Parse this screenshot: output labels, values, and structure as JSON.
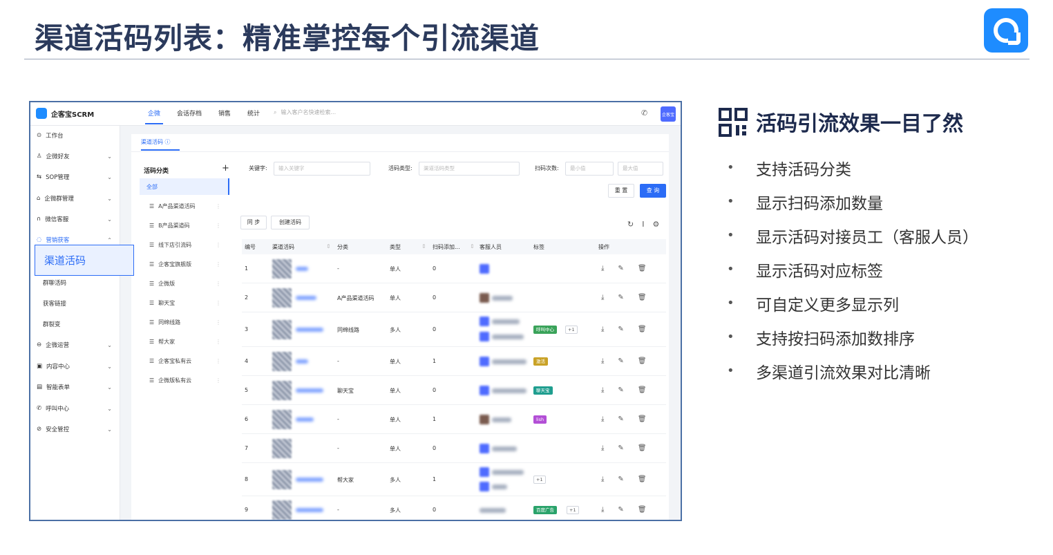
{
  "slide": {
    "title": "渠道活码列表：精准掌控每个引流渠道"
  },
  "app": {
    "logo_text": "企客宝SCRM",
    "nav": [
      "企微",
      "会话存档",
      "销售",
      "统计"
    ],
    "search_placeholder": "输入客户名快速检索...",
    "avatar_label": "企客宝",
    "sidebar": [
      {
        "label": "工作台",
        "icon": "home-icon"
      },
      {
        "label": "企微好友",
        "icon": "user-icon"
      },
      {
        "label": "SOP管理",
        "icon": "sop-icon"
      },
      {
        "label": "企微群管理",
        "icon": "group-icon"
      },
      {
        "label": "微信客服",
        "icon": "headset-icon"
      },
      {
        "label": "营销获客",
        "icon": "marketing-icon"
      },
      {
        "label": "群聊活码",
        "icon": ""
      },
      {
        "label": "获客链接",
        "icon": ""
      },
      {
        "label": "群裂变",
        "icon": ""
      },
      {
        "label": "企微运营",
        "icon": "ops-icon"
      },
      {
        "label": "内容中心",
        "icon": "content-icon"
      },
      {
        "label": "智能表单",
        "icon": "form-icon"
      },
      {
        "label": "呼叫中心",
        "icon": "call-icon"
      },
      {
        "label": "安全管控",
        "icon": "shield-icon"
      }
    ],
    "highlight_item": "渠道活码",
    "page_tab": "渠道活码 ⓘ",
    "categories_title": "活码分类",
    "categories": [
      "全部",
      "A产品渠道活码",
      "B产品渠道码",
      "线下店引流码",
      "企客宝旗舰版",
      "企微版",
      "聊天宝",
      "同绵线路",
      "帮大家",
      "企客宝私有云",
      "企微版私有云"
    ],
    "filters": {
      "keyword_label": "关键字:",
      "keyword_placeholder": "输入关键字",
      "type_label": "活码类型:",
      "type_placeholder": "渠道活码类型",
      "scan_label": "扫码次数:",
      "scan_min": "最小值",
      "scan_max": "最大值",
      "reset": "重 置",
      "query": "查 询"
    },
    "actions": {
      "sync": "同 步",
      "create": "创建活码"
    },
    "table": {
      "headers": [
        "编号",
        "渠道活码",
        "分类",
        "类型",
        "扫码添加...",
        "客服人员",
        "标签",
        "操作"
      ],
      "rows": [
        {
          "no": "1",
          "category": "-",
          "type": "单人",
          "scans": "0",
          "tag": "",
          "more": ""
        },
        {
          "no": "2",
          "category": "A产品渠道活码",
          "type": "单人",
          "scans": "0",
          "tag": "",
          "more": ""
        },
        {
          "no": "3",
          "category": "同绵线路",
          "type": "多人",
          "scans": "0",
          "tag": "呼叫中心",
          "more": "+1"
        },
        {
          "no": "4",
          "category": "-",
          "type": "单人",
          "scans": "1",
          "tag": "激活",
          "more": ""
        },
        {
          "no": "5",
          "category": "聊天宝",
          "type": "单人",
          "scans": "0",
          "tag": "聊天宝",
          "more": ""
        },
        {
          "no": "6",
          "category": "-",
          "type": "单人",
          "scans": "1",
          "tag": "lish",
          "more": ""
        },
        {
          "no": "7",
          "category": "-",
          "type": "单人",
          "scans": "0",
          "tag": "",
          "more": ""
        },
        {
          "no": "8",
          "category": "帮大家",
          "type": "多人",
          "scans": "1",
          "tag": "",
          "more": "+1"
        },
        {
          "no": "9",
          "category": "-",
          "type": "多人",
          "scans": "0",
          "tag": "百度广告",
          "more": "+1"
        }
      ]
    }
  },
  "panel": {
    "heading": "活码引流效果一目了然",
    "bullets": [
      "支持活码分类",
      "显示扫码添加数量",
      "显示活码对接员工（客服人员）",
      "显示活码对应标签",
      "可自定义更多显示列",
      "支持按扫码添加数排序",
      "多渠道引流效果对比清晰"
    ]
  },
  "colors": {
    "accent": "#2b6cf6",
    "title": "#2b3a5c",
    "brand": "#1e8cff"
  }
}
